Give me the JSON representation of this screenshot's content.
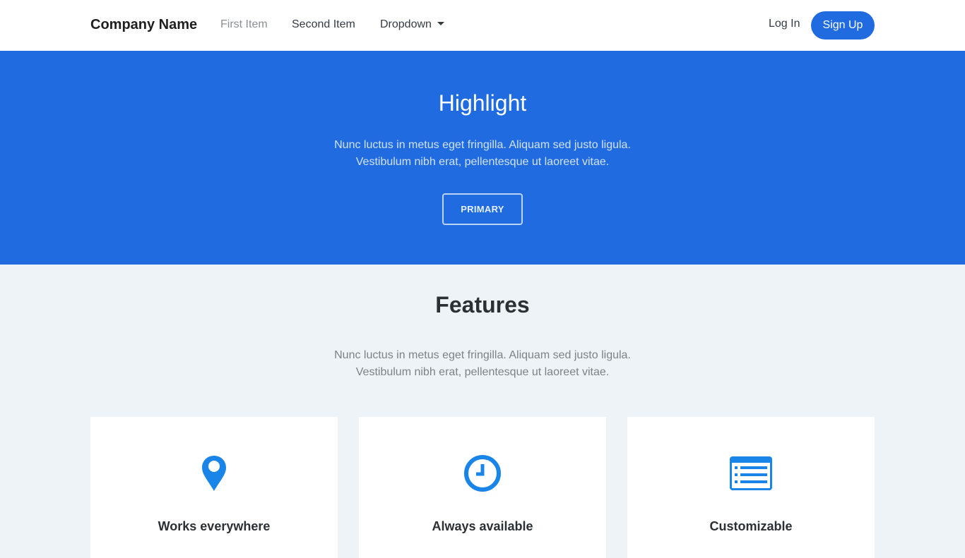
{
  "navbar": {
    "brand": "Company Name",
    "items": [
      {
        "label": "First Item"
      },
      {
        "label": "Second Item"
      },
      {
        "label": "Dropdown"
      }
    ],
    "login_label": "Log In",
    "signup_label": "Sign Up"
  },
  "hero": {
    "title": "Highlight",
    "text_line1": "Nunc luctus in metus eget fringilla. Aliquam sed justo ligula.",
    "text_line2": "Vestibulum nibh erat, pellentesque ut laoreet vitae.",
    "button_label": "PRIMARY"
  },
  "features": {
    "title": "Features",
    "text_line1": "Nunc luctus in metus eget fringilla. Aliquam sed justo ligula.",
    "text_line2": "Vestibulum nibh erat, pellentesque ut laoreet vitae.",
    "cards": [
      {
        "title": "Works everywhere",
        "icon": "map-marker-icon"
      },
      {
        "title": "Always available",
        "icon": "clock-icon"
      },
      {
        "title": "Customizable",
        "icon": "list-alt-icon"
      }
    ]
  },
  "colors": {
    "primary": "#1f6bdf",
    "icon": "#1a85e8",
    "background": "#eef3f7"
  }
}
